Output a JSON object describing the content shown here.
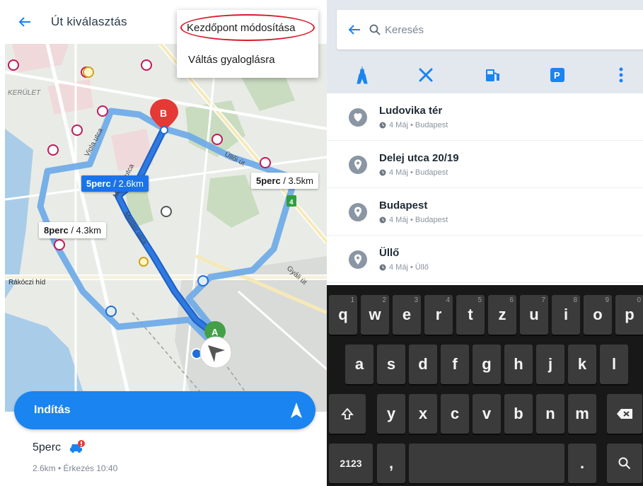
{
  "left_screen": {
    "title": "Út kiválasztás",
    "menu": {
      "items": [
        {
          "label": "Kezdőpont módosítása",
          "highlighted": true
        },
        {
          "label": "Váltás gyaloglásra"
        }
      ]
    },
    "map": {
      "place_labels": [
        "KERÜLET",
        "Viola utca",
        "Mester utca",
        "Mester utca",
        "Üllői út",
        "Rákóczi híd",
        "Gyáli út"
      ],
      "markers": {
        "start": "A",
        "end": "B"
      },
      "road_badge": "4",
      "routes": [
        {
          "time": "5perc",
          "distance": "2.6km",
          "active": true
        },
        {
          "time": "5perc",
          "distance": "3.5km",
          "active": false
        },
        {
          "time": "8perc",
          "distance": "4.3km",
          "active": false
        }
      ]
    },
    "start_button": {
      "label": "Indítás"
    },
    "summary": {
      "time": "5perc",
      "details": "2.6km • Érkezés 10:40"
    },
    "colors": {
      "primary": "#1a84f0",
      "route_active": "#1e6fd9",
      "route_alt": "#6aa8e8",
      "highlight": "#d81b2a"
    }
  },
  "right_screen": {
    "search": {
      "placeholder": "Keresés"
    },
    "categories": [
      "landmark-icon",
      "restaurant-icon",
      "fuel-icon",
      "parking-icon",
      "more-icon"
    ],
    "parking_letter": "P",
    "results": [
      {
        "title": "Ludovika tér",
        "meta": "4 Máj • Budapest",
        "icon": "heart-pin-icon"
      },
      {
        "title": "Delej utca 20/19",
        "meta": "4 Máj • Budapest",
        "icon": "pin-icon"
      },
      {
        "title": "Budapest",
        "meta": "4 Máj • Budapest",
        "icon": "pin-icon"
      },
      {
        "title": "Üllő",
        "meta": "4 Máj • Üllő",
        "icon": "pin-icon"
      }
    ],
    "keyboard": {
      "row1": [
        {
          "k": "q",
          "h": "1"
        },
        {
          "k": "w",
          "h": "2"
        },
        {
          "k": "e",
          "h": "3"
        },
        {
          "k": "r",
          "h": "4"
        },
        {
          "k": "t",
          "h": "5"
        },
        {
          "k": "z",
          "h": "6"
        },
        {
          "k": "u",
          "h": "7"
        },
        {
          "k": "i",
          "h": "8"
        },
        {
          "k": "o",
          "h": "9"
        },
        {
          "k": "p",
          "h": "0"
        }
      ],
      "row2": [
        "a",
        "s",
        "d",
        "f",
        "g",
        "h",
        "j",
        "k",
        "l"
      ],
      "row3": [
        "y",
        "x",
        "c",
        "v",
        "b",
        "n",
        "m"
      ],
      "numbers_key": "2123",
      "comma_key": ",",
      "period_key": "."
    }
  }
}
